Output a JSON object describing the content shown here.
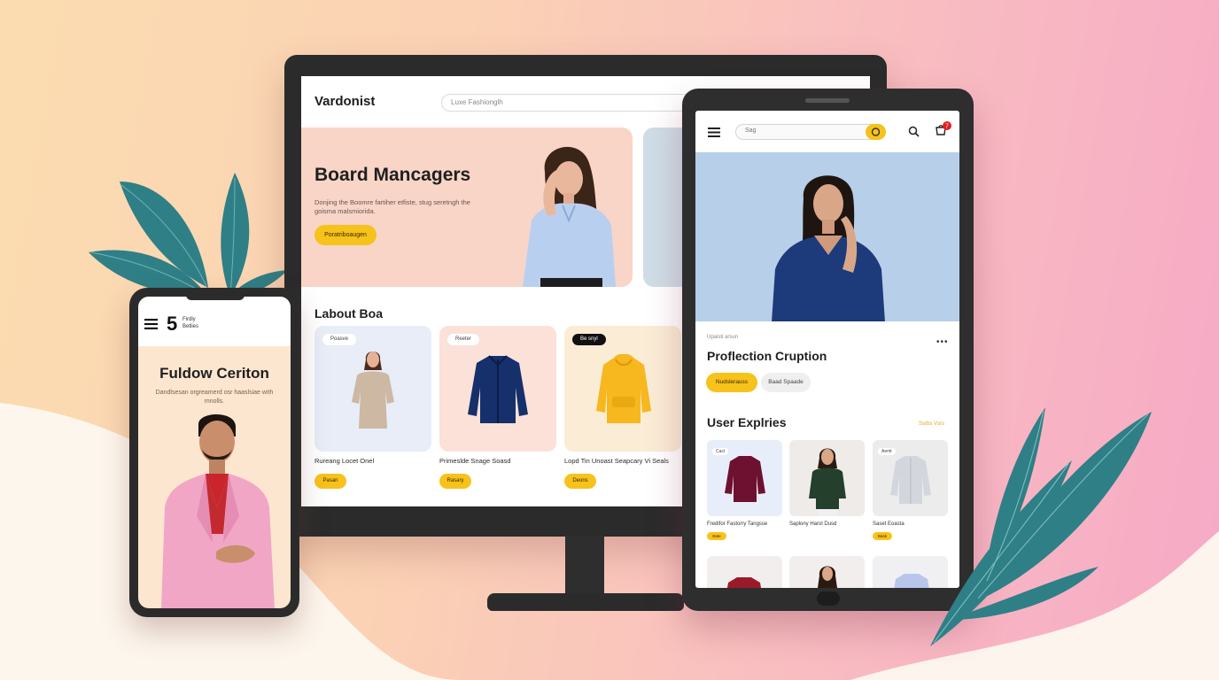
{
  "colors": {
    "accent": "#f7c21b",
    "hero_desktop": "#f8d5c7",
    "hero_tablet": "#b7cfe8",
    "phone_bg": "#fde6cf",
    "device_frame": "#2b2b2b",
    "leaf": "#2f7f86"
  },
  "desktop": {
    "logo": "Vardonist",
    "search_placeholder": "Luxe Fashionglh",
    "hero": {
      "title": "Board Mancagers",
      "text": "Donjing the Boomre fartiher etfiste, stug seretngh the goisma malsmiorida.",
      "button": "Poratriboaugen"
    },
    "section_title": "Labout Boa",
    "products": [
      {
        "tag": "Poasve",
        "name": "Rureang Locet Onel",
        "button": "Pasan",
        "icon": "beige-sweater-model-image"
      },
      {
        "tag": "Reeter",
        "name": "Primeslde Snage Soasd",
        "button": "Rasary",
        "icon": "navy-jacket-image"
      },
      {
        "tag": "Be snyl",
        "name": "Lopd Tin Unoast Seapcary Vi Seals",
        "button": "Deons",
        "icon": "yellow-hoodie-image"
      }
    ]
  },
  "tablet": {
    "search_placeholder": "Sag",
    "cart_count": "7",
    "subtitle": "Upaisti arsun",
    "title": "Proflection Cruption",
    "pill_primary": "Nudslerauss",
    "pill_secondary": "Baad Spaade",
    "section_title": "User Explries",
    "section_link": "Ssrbs Vsrs",
    "products": [
      {
        "tag": "Cact",
        "name": "Fredifor Fastorry Tangsse",
        "badge": "Eate",
        "icon": "burgundy-sweater-image"
      },
      {
        "tag": "",
        "name": "Saplony Harol Dusd",
        "badge": "",
        "icon": "green-sweater-model-image"
      },
      {
        "tag": "Aemt",
        "name": "Saset Eoasta",
        "badge": "Bask",
        "icon": "grey-shirt-image"
      }
    ]
  },
  "phone": {
    "logo_number": "5",
    "logo_line1": "Firdly",
    "logo_line2": "Betlies",
    "title": "Fuldow Ceriton",
    "text": "Dandlsesan orgreamerd osr haaslsiae with mnolls."
  }
}
